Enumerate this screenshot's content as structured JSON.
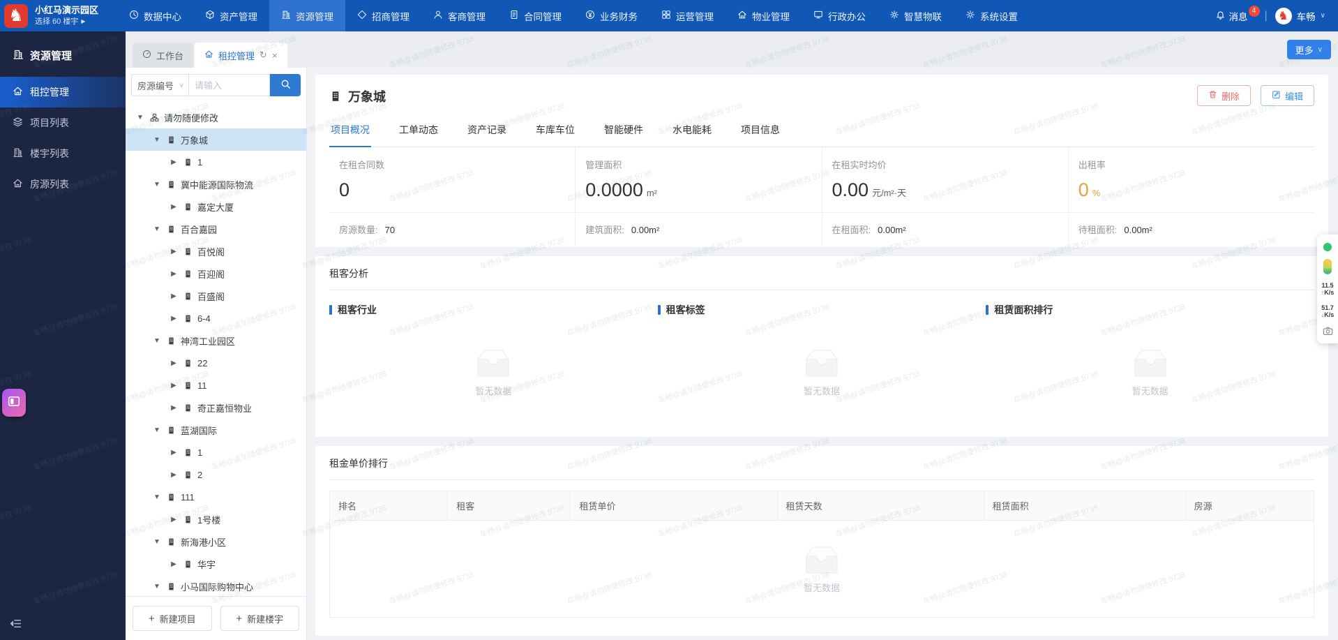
{
  "topbar": {
    "logo_title": "小红马演示园区",
    "logo_subtitle": "选择 60 楼宇",
    "nav": [
      {
        "label": "数据中心",
        "icon": "clock"
      },
      {
        "label": "资产管理",
        "icon": "cube"
      },
      {
        "label": "资源管理",
        "icon": "building"
      },
      {
        "label": "招商管理",
        "icon": "diamond"
      },
      {
        "label": "客商管理",
        "icon": "person"
      },
      {
        "label": "合同管理",
        "icon": "doc"
      },
      {
        "label": "业务财务",
        "icon": "finance"
      },
      {
        "label": "运营管理",
        "icon": "ops"
      },
      {
        "label": "物业管理",
        "icon": "home"
      },
      {
        "label": "行政办公",
        "icon": "monitor"
      },
      {
        "label": "智慧物联",
        "icon": "iot"
      },
      {
        "label": "系统设置",
        "icon": "gear"
      }
    ],
    "active_nav": "资源管理",
    "messages_label": "消息",
    "messages_count": "4",
    "user_name": "车畅"
  },
  "sidebar": {
    "title": "资源管理",
    "items": [
      {
        "label": "租控管理",
        "icon": "home",
        "active": true
      },
      {
        "label": "项目列表",
        "icon": "layers",
        "active": false
      },
      {
        "label": "楼宇列表",
        "icon": "building",
        "active": false
      },
      {
        "label": "房源列表",
        "icon": "home",
        "active": false
      }
    ]
  },
  "tabbar": {
    "tabs": [
      {
        "label": "工作台",
        "icon": "dashboard",
        "active": false,
        "closable": false
      },
      {
        "label": "租控管理",
        "icon": "home",
        "active": true,
        "closable": true
      }
    ],
    "more_label": "更多"
  },
  "tree_panel": {
    "filter_label": "房源编号",
    "input_placeholder": "请输入",
    "nodes": [
      {
        "level": 0,
        "label": "请勿随便修改",
        "arrow": "down",
        "icon": "org",
        "selected": false
      },
      {
        "level": 1,
        "label": "万象城",
        "arrow": "down",
        "icon": "building",
        "selected": true
      },
      {
        "level": 2,
        "label": "1",
        "arrow": "right",
        "icon": "building",
        "selected": false
      },
      {
        "level": 1,
        "label": "冀中能源国际物流",
        "arrow": "down",
        "icon": "building",
        "selected": false
      },
      {
        "level": 2,
        "label": "嘉定大厦",
        "arrow": "right",
        "icon": "building",
        "selected": false
      },
      {
        "level": 1,
        "label": "百合嘉园",
        "arrow": "down",
        "icon": "building",
        "selected": false
      },
      {
        "level": 2,
        "label": "百悦阁",
        "arrow": "right",
        "icon": "building",
        "selected": false
      },
      {
        "level": 2,
        "label": "百迎阁",
        "arrow": "right",
        "icon": "building",
        "selected": false
      },
      {
        "level": 2,
        "label": "百盛阁",
        "arrow": "right",
        "icon": "building",
        "selected": false
      },
      {
        "level": 2,
        "label": "6-4",
        "arrow": "right",
        "icon": "building",
        "selected": false
      },
      {
        "level": 1,
        "label": "神湾工业园区",
        "arrow": "down",
        "icon": "building",
        "selected": false
      },
      {
        "level": 2,
        "label": "22",
        "arrow": "right",
        "icon": "building",
        "selected": false
      },
      {
        "level": 2,
        "label": "11",
        "arrow": "right",
        "icon": "building",
        "selected": false
      },
      {
        "level": 2,
        "label": "奇正嘉恒物业",
        "arrow": "right",
        "icon": "building",
        "selected": false
      },
      {
        "level": 1,
        "label": "蓝湖国际",
        "arrow": "down",
        "icon": "building",
        "selected": false
      },
      {
        "level": 2,
        "label": "1",
        "arrow": "right",
        "icon": "building",
        "selected": false
      },
      {
        "level": 2,
        "label": "2",
        "arrow": "right",
        "icon": "building",
        "selected": false
      },
      {
        "level": 1,
        "label": "111",
        "arrow": "down",
        "icon": "building",
        "selected": false
      },
      {
        "level": 2,
        "label": "1号楼",
        "arrow": "right",
        "icon": "building",
        "selected": false
      },
      {
        "level": 1,
        "label": "新海港小区",
        "arrow": "down",
        "icon": "building",
        "selected": false
      },
      {
        "level": 2,
        "label": "华宇",
        "arrow": "right",
        "icon": "building",
        "selected": false
      },
      {
        "level": 1,
        "label": "小马国际购物中心",
        "arrow": "down",
        "icon": "building",
        "selected": false
      }
    ],
    "new_project_label": "新建项目",
    "new_building_label": "新建楼宇"
  },
  "main": {
    "title": "万象城",
    "delete_label": "删除",
    "edit_label": "编辑",
    "tabs": [
      "项目概况",
      "工单动态",
      "资产记录",
      "车库车位",
      "智能硬件",
      "水电能耗",
      "项目信息"
    ],
    "active_tab": "项目概况",
    "stats": [
      {
        "label": "在租合同数",
        "value": "0",
        "unit": "",
        "color": "#303133"
      },
      {
        "label": "管理面积",
        "value": "0.0000",
        "unit": "m²",
        "color": "#303133"
      },
      {
        "label": "在租实时均价",
        "value": "0.00",
        "unit": "元/m²·天",
        "color": "#303133"
      },
      {
        "label": "出租率",
        "value": "0",
        "unit": "%",
        "color": "#e6a23c"
      }
    ],
    "substats": [
      {
        "label": "房源数量:",
        "value": "70"
      },
      {
        "label": "建筑面积:",
        "value": "0.00m²"
      },
      {
        "label": "在租面积:",
        "value": "0.00m²"
      },
      {
        "label": "待租面积:",
        "value": "0.00m²"
      }
    ],
    "tenant_section_title": "租客分析",
    "tenant_panels": [
      "租客行业",
      "租客标签",
      "租赁面积排行"
    ],
    "empty_text": "暂无数据",
    "rank_section_title": "租金单价排行",
    "table_headers": [
      "排名",
      "租客",
      "租赁单价",
      "租赁天数",
      "租赁面积",
      "房源"
    ]
  },
  "net_widget": {
    "up_value": "11.5",
    "up_unit": "K/s",
    "down_value": "51.7",
    "down_unit": "K/s"
  },
  "watermark_text": "车畅@请勿随便修改 9738"
}
